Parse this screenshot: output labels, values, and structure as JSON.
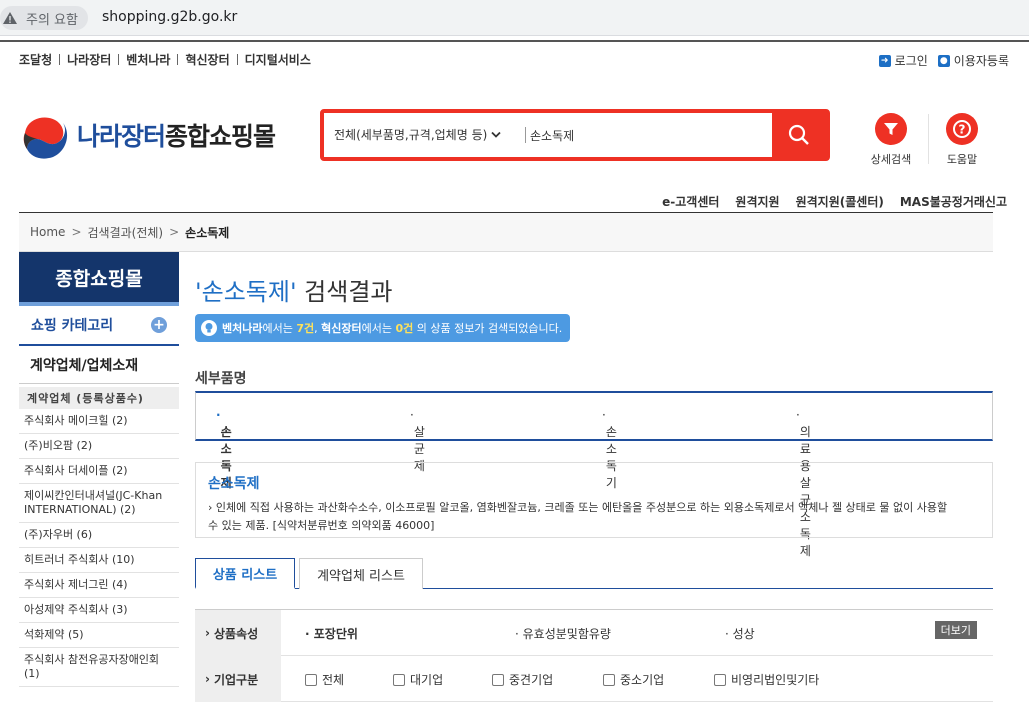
{
  "browser": {
    "security_label": "주의 요함",
    "url": "shopping.g2b.go.kr"
  },
  "gnb": [
    "조달청",
    "나라장터",
    "벤처나라",
    "혁신장터",
    "디지털서비스"
  ],
  "util": {
    "login": "로그인",
    "register": "이용자등록"
  },
  "logo": {
    "part_a": "나라장터",
    "part_b": "종합쇼핑몰"
  },
  "search": {
    "scope": "전체(세부품명,규격,업체명 등)",
    "query": "손소독제"
  },
  "header_buttons": {
    "advanced": "상세검색",
    "help": "도움말"
  },
  "quick_links": [
    "e-고객센터",
    "원격지원",
    "원격지원(콜센터)",
    "MAS불공정거래신고"
  ],
  "breadcrumb": {
    "home": "Home",
    "level1": "검색결과(전체)",
    "current": "손소독제"
  },
  "sidebar": {
    "title": "종합쇼핑몰",
    "category": "쇼핑 카테고리",
    "section": "계약업체/업체소재",
    "list_head": "계약업체 (등록상품수)",
    "vendors": [
      "주식회사 메이크힐 (2)",
      "(주)비오팜 (2)",
      "주식회사 더세이플 (2)",
      "제이씨칸인터내셔널(JC-Khan INTERNATIONAL) (2)",
      "(주)자우버 (6)",
      "히트러너 주식회사 (10)",
      "주식회사 제너그린 (4)",
      "아성제약 주식회사 (3)",
      "석화제약 (5)",
      "주식회사 참전유공자장애인회 (1)"
    ]
  },
  "result": {
    "q_open": "'",
    "keyword": "손소독제",
    "q_close": "'",
    "title_suffix": " 검색결과",
    "notice": {
      "venture": "벤처나라",
      "t1": "에서는 ",
      "venture_count": "7건",
      "t2": ", ",
      "innov": "혁신장터",
      "t3": "에서는 ",
      "innov_count": "0건",
      "t4": " 의 상품 정보가 검색되었습니다."
    }
  },
  "detail_name": {
    "label": "세부품명",
    "items": [
      "손소독제",
      "살균제",
      "손소독기",
      "의료용살균소독제"
    ]
  },
  "description": {
    "title": "손소독제",
    "text": "인체에 직접 사용하는 과산화수소수, 이소프로필 알코올, 염화벤잘코늄, 크레졸 또는 에탄올을 주성분으로 하는 외용소독제로서 액체나 젤 상태로 물 없이 사용할 수 있는 제품. [식약처분류번호 의약외품 46000]"
  },
  "tabs": [
    "상품 리스트",
    "계약업체 리스트"
  ],
  "attributes": {
    "row1": {
      "label": "상품속성",
      "items": [
        "포장단위",
        "유효성분및함유량",
        "성상"
      ],
      "more": "더보기"
    },
    "row2": {
      "label": "기업구분",
      "options": [
        "전체",
        "대기업",
        "중견기업",
        "중소기업",
        "비영리법인및기타"
      ]
    }
  }
}
